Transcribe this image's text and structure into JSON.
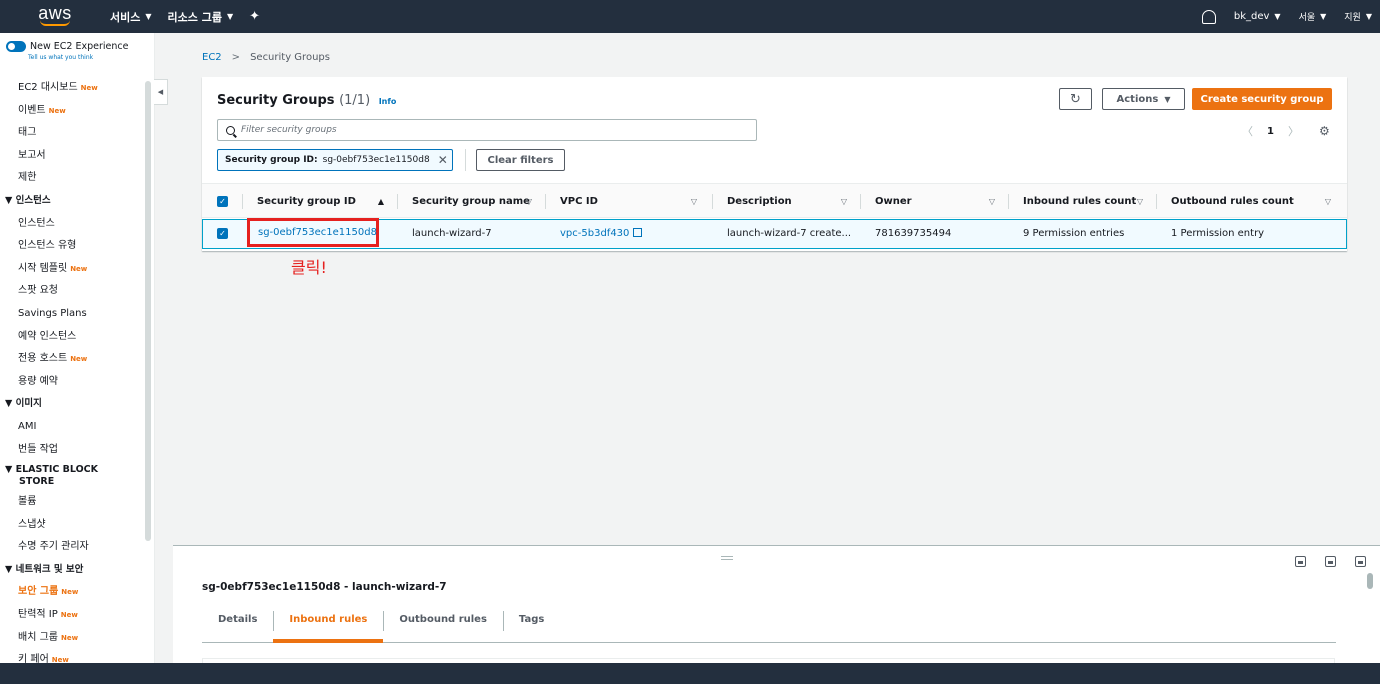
{
  "topnav": {
    "logo": "aws",
    "services": "서비스",
    "resource_groups": "리소스 그룹",
    "user": "bk_dev",
    "region": "서울",
    "support": "지원"
  },
  "sidebar": {
    "experience_label": "New EC2 Experience",
    "experience_sub": "Tell us what you think",
    "items": [
      {
        "type": "link",
        "label": "EC2 대시보드",
        "new": "New"
      },
      {
        "type": "link",
        "label": "이벤트",
        "new": "New"
      },
      {
        "type": "link",
        "label": "태그",
        "new": ""
      },
      {
        "type": "link",
        "label": "보고서",
        "new": ""
      },
      {
        "type": "link",
        "label": "제한",
        "new": ""
      },
      {
        "type": "head",
        "label": "▼ 인스턴스"
      },
      {
        "type": "link",
        "label": "인스턴스",
        "new": ""
      },
      {
        "type": "link",
        "label": "인스턴스 유형",
        "new": ""
      },
      {
        "type": "link",
        "label": "시작 템플릿",
        "new": "New"
      },
      {
        "type": "link",
        "label": "스팟 요청",
        "new": ""
      },
      {
        "type": "link",
        "label": "Savings Plans",
        "new": ""
      },
      {
        "type": "link",
        "label": "예약 인스턴스",
        "new": ""
      },
      {
        "type": "link",
        "label": "전용 호스트",
        "new": "New"
      },
      {
        "type": "link",
        "label": "용량 예약",
        "new": ""
      },
      {
        "type": "head",
        "label": "▼ 이미지"
      },
      {
        "type": "link",
        "label": "AMI",
        "new": ""
      },
      {
        "type": "link",
        "label": "번들 작업",
        "new": ""
      },
      {
        "type": "head2",
        "label": "▼ ELASTIC BLOCK",
        "label2": "STORE"
      },
      {
        "type": "link",
        "label": "볼륨",
        "new": ""
      },
      {
        "type": "link",
        "label": "스냅샷",
        "new": ""
      },
      {
        "type": "link",
        "label": "수명 주기 관리자",
        "new": ""
      },
      {
        "type": "head",
        "label": "▼ 네트워크 및 보안"
      },
      {
        "type": "active",
        "label": "보안 그룹",
        "new": "New"
      },
      {
        "type": "link",
        "label": "탄력적 IP",
        "new": "New"
      },
      {
        "type": "link",
        "label": "배치 그룹",
        "new": "New"
      },
      {
        "type": "link",
        "label": "키 페어",
        "new": "New"
      }
    ]
  },
  "breadcrumb": {
    "root": "EC2",
    "sep": ">",
    "current": "Security Groups"
  },
  "panel": {
    "title": "Security Groups",
    "count": "(1/1)",
    "info": "Info",
    "refresh_icon": "refresh-icon",
    "actions": "Actions",
    "create": "Create security group",
    "search_placeholder": "Filter security groups",
    "page": "1",
    "filter_token_key": "Security group ID:",
    "filter_token_value": "sg-0ebf753ec1e1150d8",
    "clear_filters": "Clear filters"
  },
  "table": {
    "columns": [
      "Security group ID",
      "Security group name",
      "VPC ID",
      "Description",
      "Owner",
      "Inbound rules count",
      "Outbound rules count"
    ],
    "row": {
      "sg_id": "sg-0ebf753ec1e1150d8",
      "name": "launch-wizard-7",
      "vpc": "vpc-5b3df430",
      "description": "launch-wizard-7 create...",
      "owner": "781639735494",
      "inbound": "9 Permission entries",
      "outbound": "1 Permission entry"
    }
  },
  "annotation": "클릭!",
  "split": {
    "title": "sg-0ebf753ec1e1150d8 - launch-wizard-7",
    "tabs": [
      "Details",
      "Inbound rules",
      "Outbound rules",
      "Tags"
    ],
    "active_tab": "Inbound rules"
  },
  "colors": {
    "accent": "#ec7211",
    "link": "#0073bb",
    "nav": "#232f3e",
    "highlight": "#e5211f"
  }
}
